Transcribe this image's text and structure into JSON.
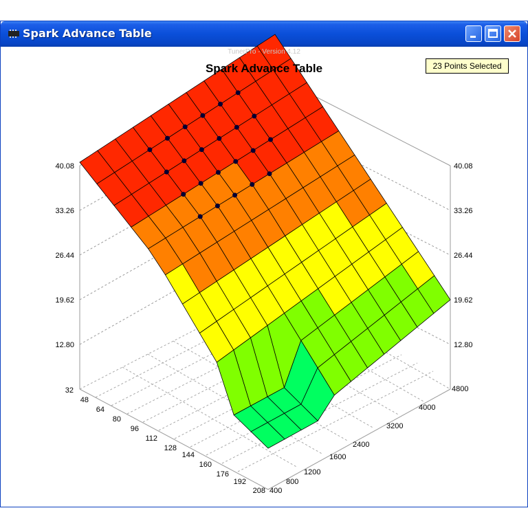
{
  "window": {
    "title": "Spark Advance Table",
    "icon": "chip-icon",
    "title_color": "#0a4fd9"
  },
  "header": {
    "version": "TunerPro - Version 4.12",
    "badge": "23 Points Selected"
  },
  "chart_data": {
    "type": "surface",
    "title": "Spark Advance Table",
    "z_ticks": [
      "40.08",
      "33.26",
      "26.44",
      "19.62",
      "12.80"
    ],
    "z_range": [
      12.8,
      40.08
    ],
    "y_ticks": [
      "32",
      "48",
      "64",
      "80",
      "96",
      "112",
      "128",
      "144",
      "160",
      "176",
      "192",
      "208"
    ],
    "x_ticks": [
      "400",
      "800",
      "1200",
      "1600",
      "2400",
      "3200",
      "4000",
      "4800"
    ],
    "selected_points": 23,
    "colormap": [
      "#00e8ff",
      "#00ff60",
      "#80ff00",
      "#ffff00",
      "#ff8000",
      "#ff2800"
    ]
  }
}
